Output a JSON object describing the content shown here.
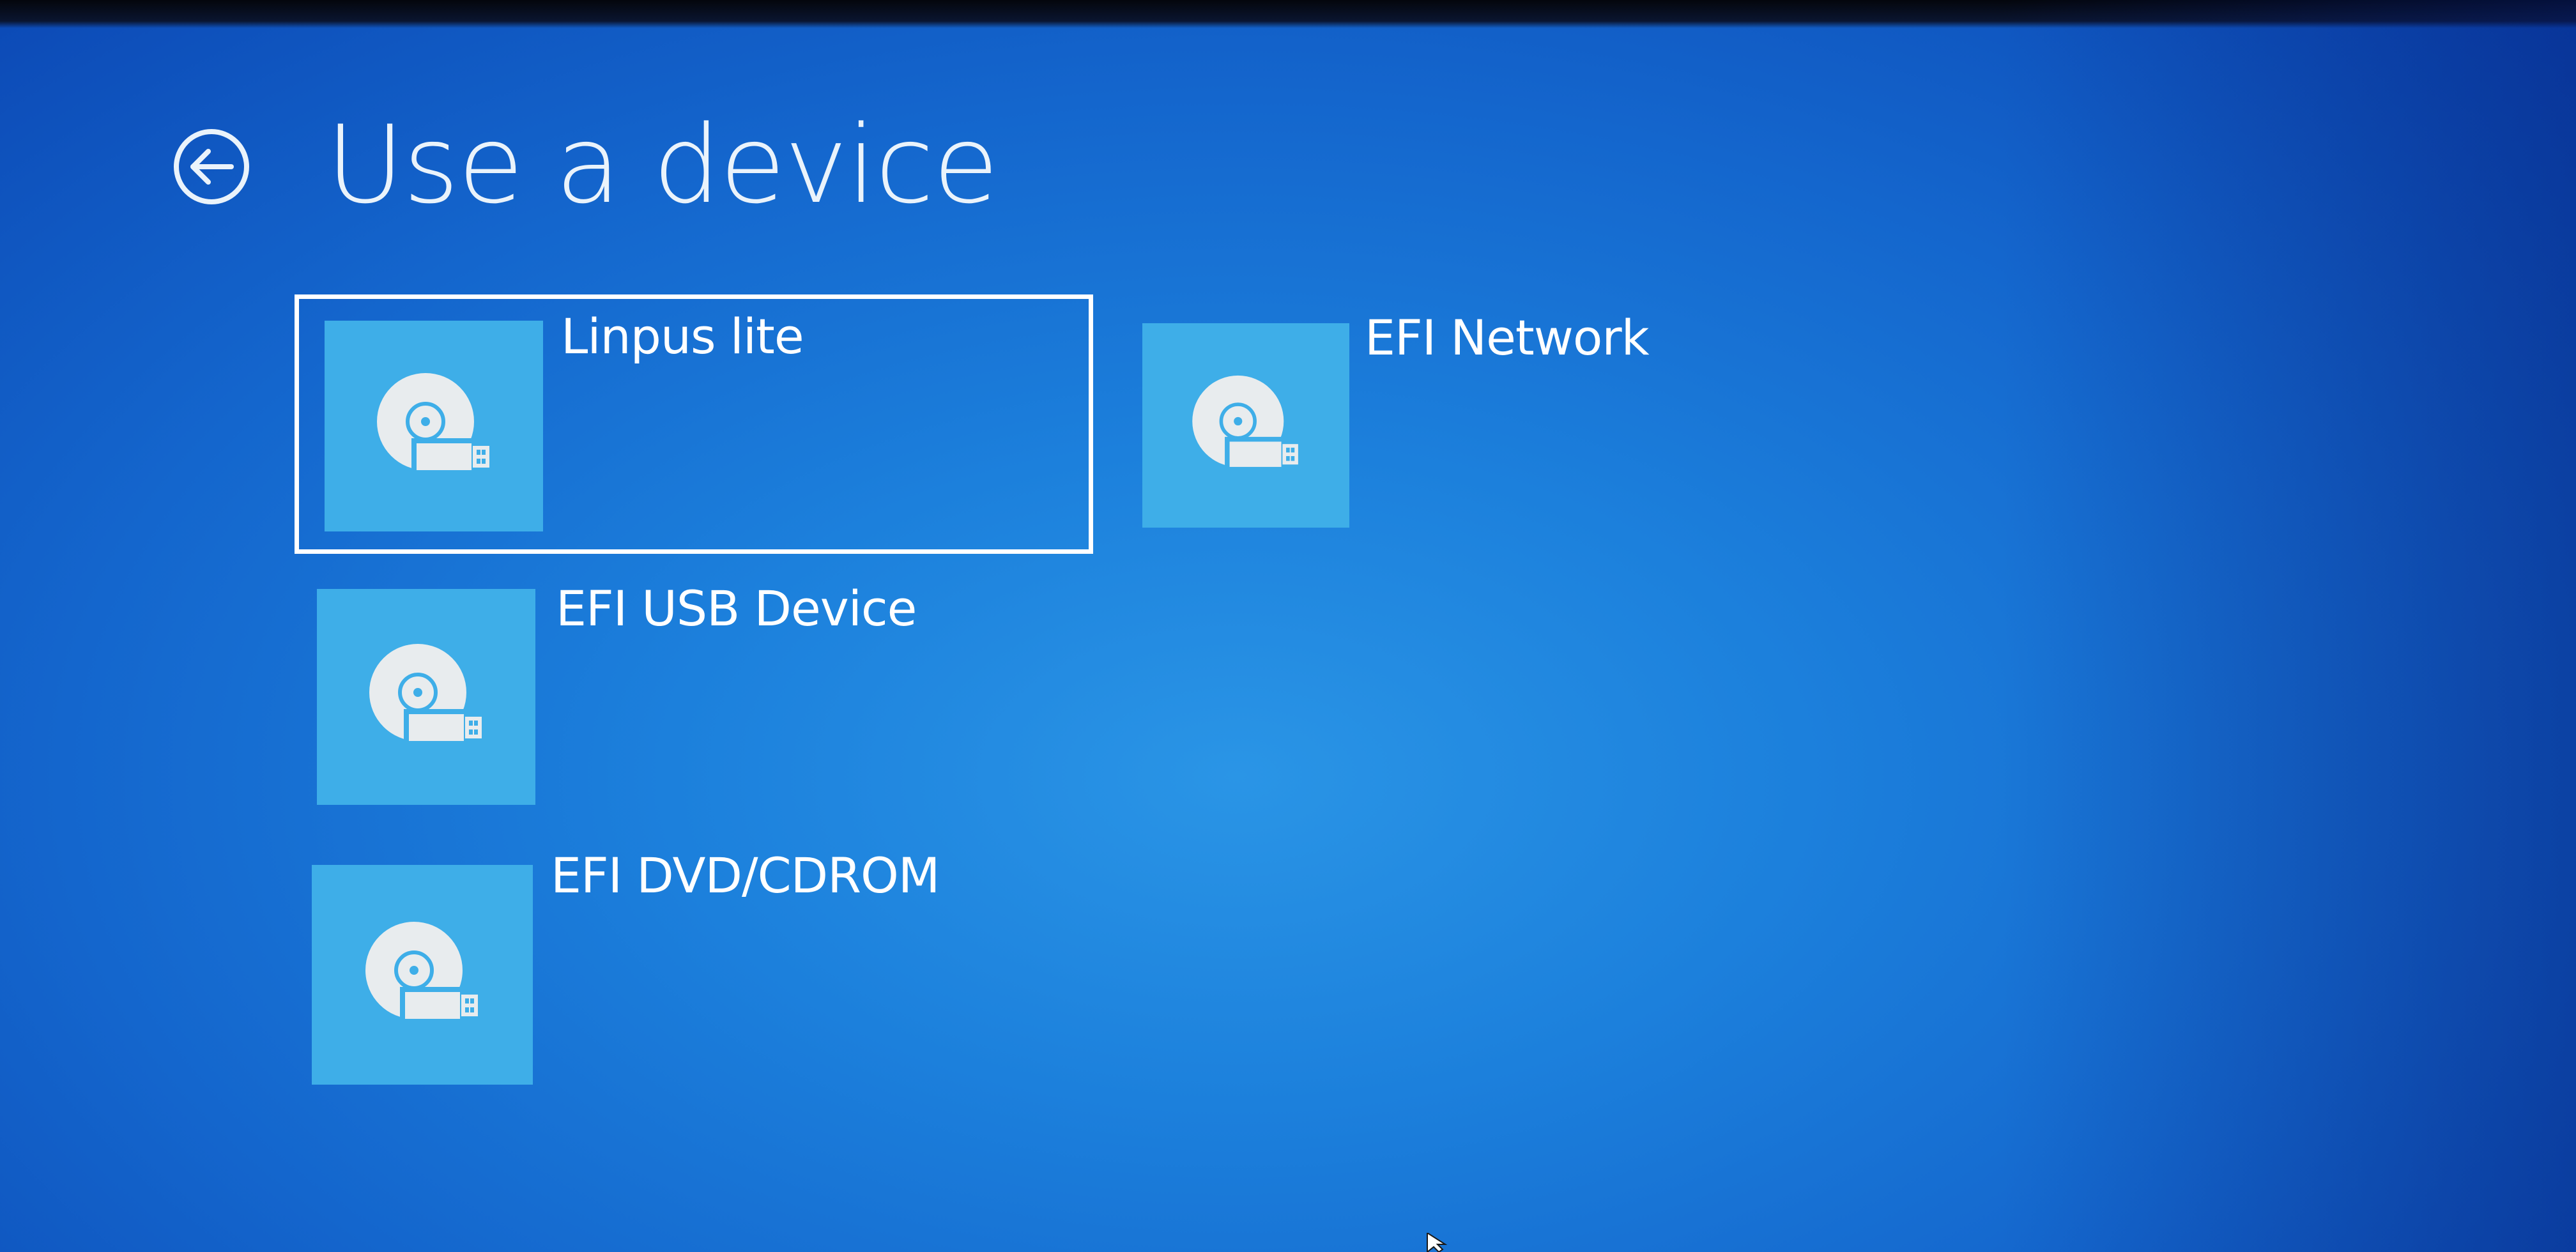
{
  "header": {
    "title": "Use a device",
    "back_icon": "back-arrow-circle-icon"
  },
  "devices": [
    {
      "label": "Linpus lite",
      "icon": "disc-usb-drive-icon",
      "selected": true
    },
    {
      "label": "EFI Network",
      "icon": "disc-usb-drive-icon",
      "selected": false
    },
    {
      "label": "EFI USB Device",
      "icon": "disc-usb-drive-icon",
      "selected": false
    },
    {
      "label": "EFI DVD/CDROM",
      "icon": "disc-usb-drive-icon",
      "selected": false
    }
  ],
  "colors": {
    "background": "#1c80dc",
    "tile": "#3eaee8",
    "text": "#ffffff",
    "selection_border": "#ffffff"
  }
}
